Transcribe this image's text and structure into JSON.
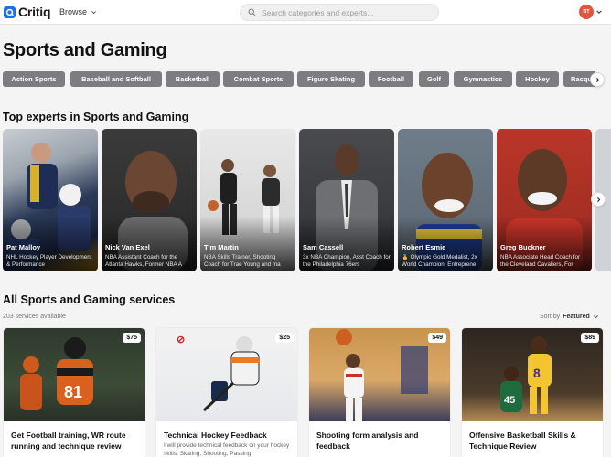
{
  "header": {
    "logo_text": "Critiq",
    "browse_label": "Browse",
    "search_placeholder": "Search categories and experts...",
    "avatar_initials": "BT",
    "colors": {
      "brand": "#1c6fe8",
      "avatar": "#e5533d"
    }
  },
  "page": {
    "title": "Sports and Gaming"
  },
  "chips": [
    "Action Sports",
    "Baseball and Softball",
    "Basketball",
    "Combat Sports",
    "Figure Skating",
    "Football",
    "Golf",
    "Gymnastics",
    "Hockey",
    "Racquet"
  ],
  "experts_section": {
    "title": "Top experts in Sports and Gaming",
    "items": [
      {
        "name": "Pat Malloy",
        "desc": "NHL Hockey Player Development & Performance"
      },
      {
        "name": "Nick Van Exel",
        "desc": "NBA Assistant Coach for the Atlanta Hawks, Former NBA A"
      },
      {
        "name": "Tim Martin",
        "desc": "NBA Skills Trainer, Shooting Coach for Trae Young and ma"
      },
      {
        "name": "Sam Cassell",
        "desc": "3x NBA Champion, Asst Coach for the Philadelphia 76ers"
      },
      {
        "name": "Robert Esmie",
        "desc": "🥇 Olympic Gold Medalist, 2x World Champion, Entreprene"
      },
      {
        "name": "Greg Buckner",
        "desc": "NBA Associate Head Coach for the Cleveland Cavaliers, For"
      }
    ]
  },
  "services_section": {
    "title": "All Sports and Gaming services",
    "count_text": "203 services available",
    "sort_label": "Sort by",
    "sort_value": "Featured",
    "items": [
      {
        "price": "$75",
        "title": "Get Football training, WR route running and technique review",
        "desc": ""
      },
      {
        "price": "$25",
        "title": "Technical Hockey Feedback",
        "desc": "I will provide technical feedback on your hockey skills. Skating, Shooting, Passing,"
      },
      {
        "price": "$49",
        "title": "Shooting form analysis and feedback",
        "desc": ""
      },
      {
        "price": "$89",
        "title": "Offensive Basketball Skills & Technique Review",
        "desc": ""
      }
    ]
  }
}
